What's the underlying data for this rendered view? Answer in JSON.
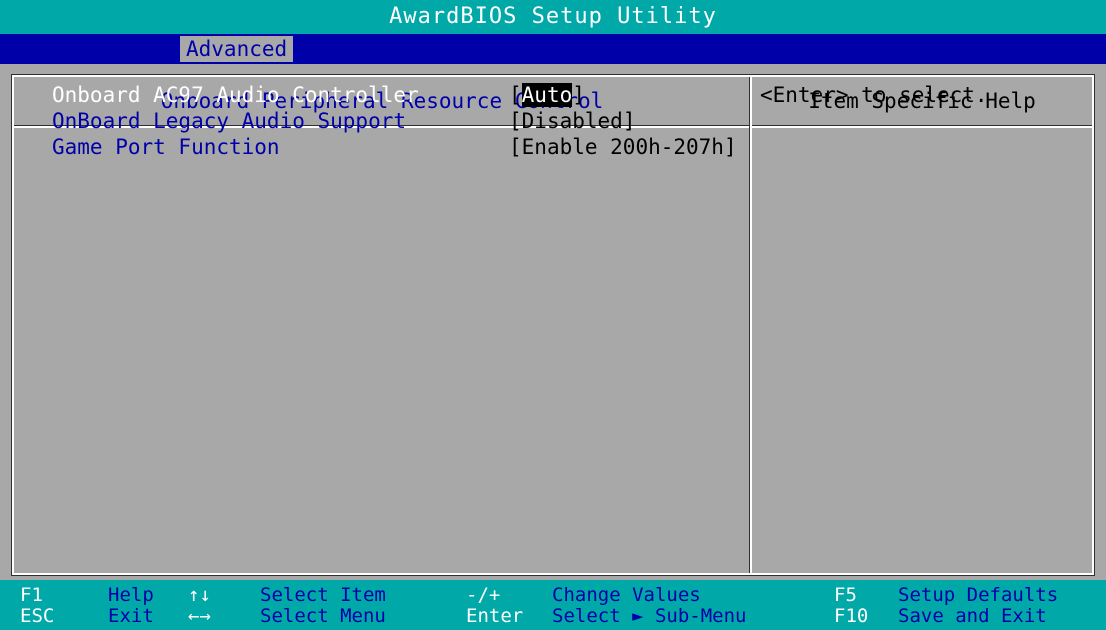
{
  "app_title": "AwardBIOS Setup Utility",
  "menu": {
    "active_tab": "Advanced"
  },
  "panel": {
    "title": "Onboard Peripheral Resource Control",
    "help_title": "Item Specific Help",
    "help_text": "<Enter> to select."
  },
  "settings": [
    {
      "label": "Onboard AC97 Audio Controller",
      "value_open": "[",
      "value": "Auto",
      "value_close": "]",
      "selected": true
    },
    {
      "label": "OnBoard Legacy Audio Support",
      "value_open": "[",
      "value": "Disabled",
      "value_close": "]",
      "selected": false
    },
    {
      "label": "Game Port Function",
      "value_open": "[",
      "value": "Enable 200h-207h",
      "value_close": "]",
      "selected": false
    }
  ],
  "keys": [
    {
      "key": "F1",
      "desc": "Help"
    },
    {
      "key": "ESC",
      "desc": "Exit"
    },
    {
      "key": "↑↓",
      "desc": "Select Item"
    },
    {
      "key": "←→",
      "desc": "Select Menu"
    },
    {
      "key": "-/+",
      "desc": "Change Values"
    },
    {
      "key": "Enter",
      "desc": "Select ► Sub-Menu"
    },
    {
      "key": "F5",
      "desc": "Setup Defaults"
    },
    {
      "key": "F10",
      "desc": "Save and Exit"
    }
  ],
  "colors": {
    "background_gray": "#a8a8a8",
    "cyan": "#00a8a8",
    "blue": "#0000a8",
    "white": "#ffffff"
  }
}
